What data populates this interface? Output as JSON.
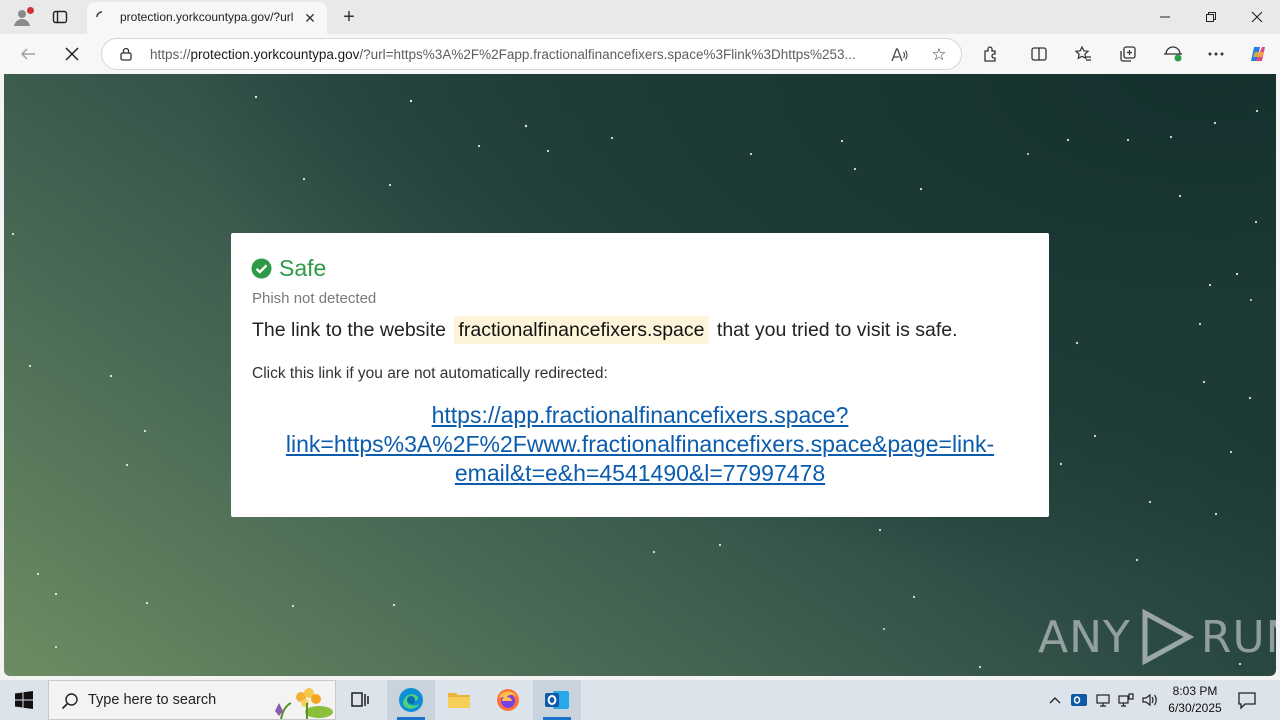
{
  "browser": {
    "tab_title": "protection.yorkcountypa.gov/?url",
    "url_prefix": "https://",
    "url_host": "protection.yorkcountypa.gov",
    "url_rest": "/?url=https%3A%2F%2Fapp.fractionalfinancefixers.space%3Flink%3Dhttps%253...",
    "read_aloud_label": "A⁾"
  },
  "page": {
    "status": "Safe",
    "subtitle": "Phish not detected",
    "message_before": "The link to the website",
    "domain": "fractionalfinancefixers.space",
    "message_after": "that you tried to visit is safe.",
    "redirect_prompt": "Click this link if you are not automatically redirected:",
    "link_text": "https://app.fractionalfinancefixers.space?link=https%3A%2F%2Fwww.fractionalfinancefixers.space&page=link-email&t=e&h=4541490&l=77997478",
    "watermark_left": "ANY",
    "watermark_right": "RUN",
    "status_color": "#2e9a47",
    "link_color": "#0b5cad"
  },
  "taskbar": {
    "search_placeholder": "Type here to search",
    "time": "8:03 PM",
    "date": "6/30/2025"
  }
}
